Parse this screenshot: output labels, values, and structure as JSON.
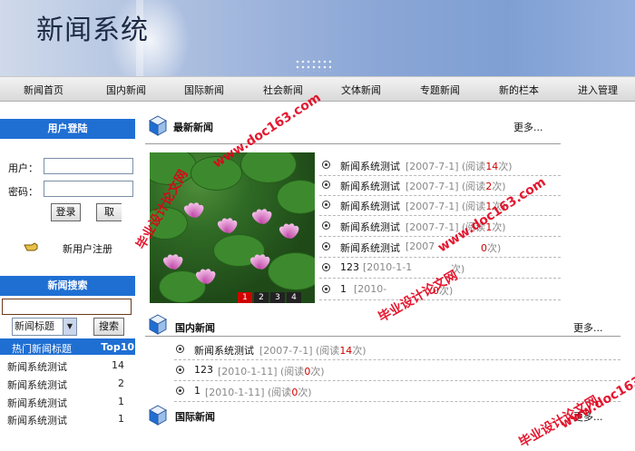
{
  "banner": {
    "title": "新闻系统"
  },
  "nav": [
    "新闻首页",
    "国内新闻",
    "国际新闻",
    "社会新闻",
    "文体新闻",
    "专题新闻",
    "新的栏本",
    "进入管理"
  ],
  "login": {
    "heading": "用户登陆",
    "user_label": "用户：",
    "pass_label": "密码：",
    "login_button": "登录",
    "cancel_button": "取",
    "register_link": "新用户注册"
  },
  "search": {
    "heading": "新闻搜索",
    "select_value": "新闻标题",
    "button": "搜索"
  },
  "hot": {
    "title": "热门新闻标题",
    "tag": "Top10",
    "rows": [
      {
        "title": "新闻系统测试",
        "count": "14"
      },
      {
        "title": "新闻系统测试",
        "count": "2"
      },
      {
        "title": "新闻系统测试",
        "count": "1"
      },
      {
        "title": "新闻系统测试",
        "count": "1"
      }
    ]
  },
  "latest": {
    "title": "最新新闻",
    "more": "更多...",
    "items": [
      {
        "title": "新闻系统测试",
        "date": "[2007-7-1]",
        "pre": "(阅读",
        "count": "14",
        "post": "次)"
      },
      {
        "title": "新闻系统测试",
        "date": "[2007-7-1]",
        "pre": "(阅读",
        "count": "2",
        "post": "次)"
      },
      {
        "title": "新闻系统测试",
        "date": "[2007-7-1]",
        "pre": "(阅读",
        "count": "1",
        "post": "次)"
      },
      {
        "title": "新闻系统测试",
        "date": "[2007-7-1]",
        "pre": "(阅读",
        "count": "1",
        "post": "次)"
      },
      {
        "title": "新闻系统测试",
        "date": "[2007",
        "pre": "",
        "count": "0",
        "post": "次)"
      },
      {
        "title": "123",
        "date": "[2010-1-1",
        "pre": "",
        "count": "",
        "post": "次)"
      },
      {
        "title": "1",
        "date": "[2010-",
        "pre": "",
        "count": "0",
        "post": "次)"
      }
    ],
    "pager": [
      "1",
      "2",
      "3",
      "4"
    ]
  },
  "domestic": {
    "title": "国内新闻",
    "more": "更多...",
    "items": [
      {
        "title": "新闻系统测试",
        "date": "[2007-7-1]",
        "pre": "(阅读",
        "count": "14",
        "post": "次)"
      },
      {
        "title": "123",
        "date": "[2010-1-11]",
        "pre": "(阅读",
        "count": "0",
        "post": "次)"
      },
      {
        "title": "1",
        "date": "[2010-1-11]",
        "pre": "(阅读",
        "count": "0",
        "post": "次)"
      }
    ]
  },
  "international": {
    "title": "国际新闻",
    "more": "更多..."
  },
  "watermarks": [
    "www.doc163.com",
    "毕业设计论文网",
    "www.doc163.com",
    "毕业设计论文网",
    "www.doc163.com",
    "毕业设计论文网"
  ],
  "colors": {
    "accent": "#1f6fd3",
    "count_red": "#d00000",
    "watermark": "#e2001a"
  }
}
